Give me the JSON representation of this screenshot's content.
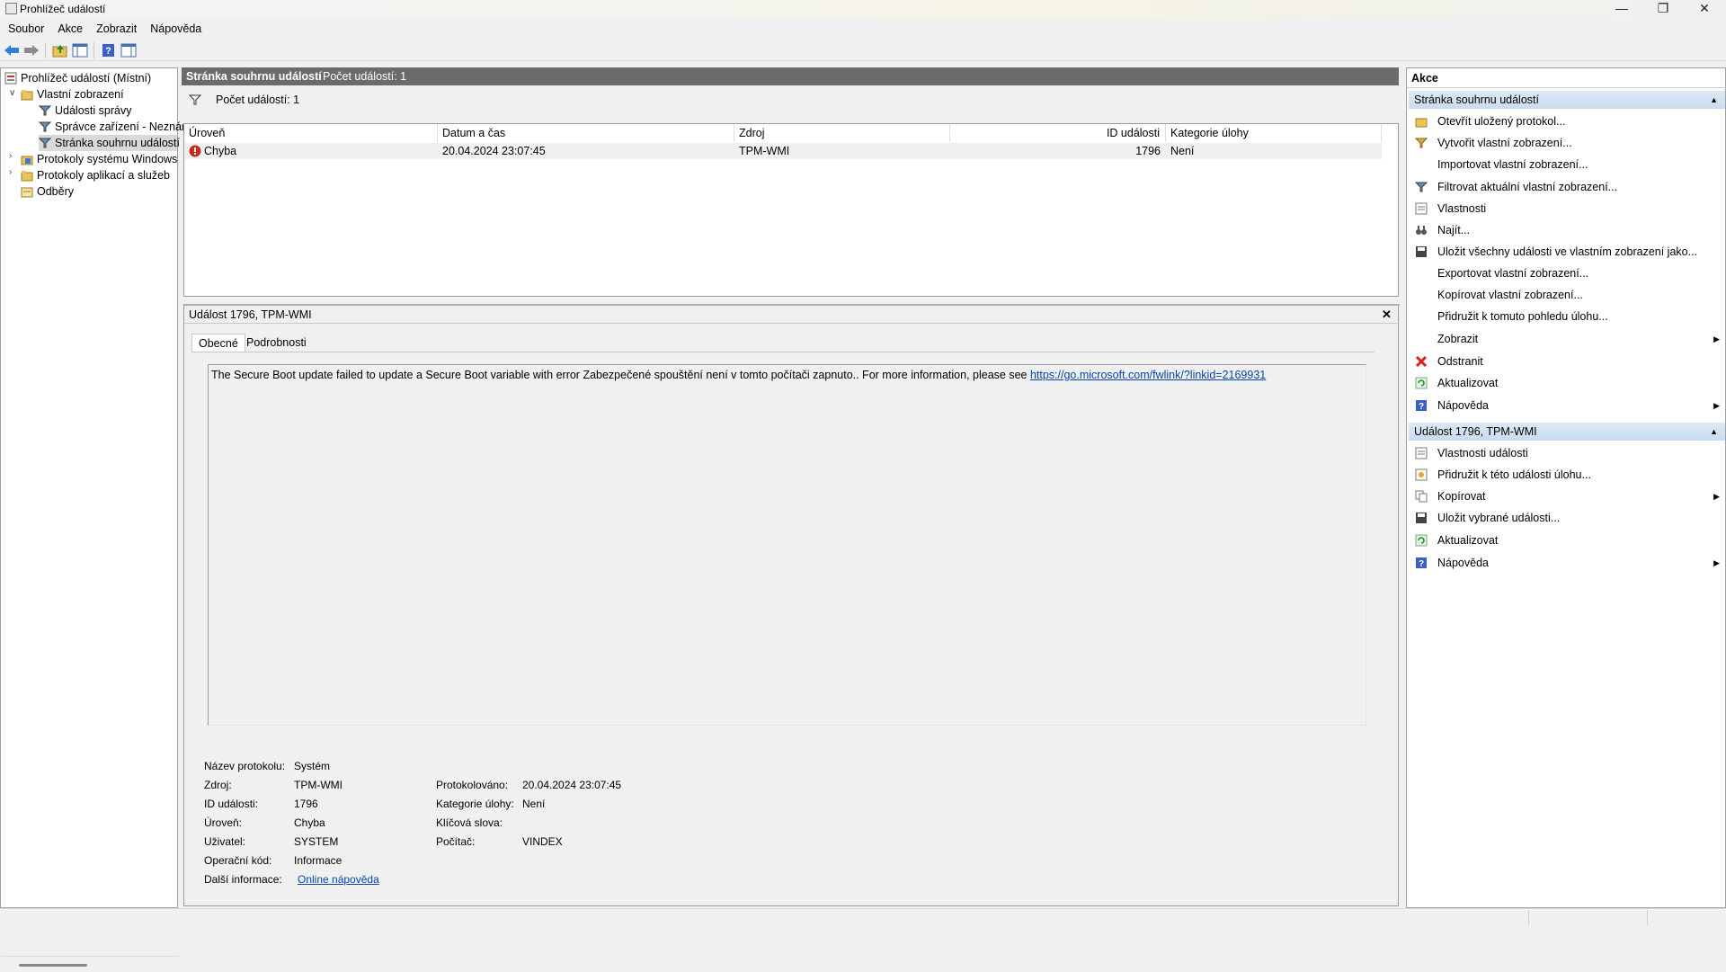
{
  "window": {
    "title": "Prohlížeč událostí"
  },
  "menu": [
    "Soubor",
    "Akce",
    "Zobrazit",
    "Nápověda"
  ],
  "tree": {
    "root": "Prohlížeč událostí (Místní)",
    "custom_views": "Vlastní zobrazení",
    "admin_events": "Události správy",
    "device_manager": "Správce zařízení - Neznár",
    "summary_page": "Stránka souhrnu událostí",
    "windows_logs": "Protokoly systému Windows",
    "app_logs": "Protokoly aplikací a služeb",
    "subscriptions": "Odběry"
  },
  "center": {
    "header_title": "Stránka souhrnu událostí",
    "header_count": "Počet událostí: 1",
    "filter_text": "Počet událostí: 1",
    "columns": [
      "Úroveň",
      "Datum a čas",
      "Zdroj",
      "ID události",
      "Kategorie úlohy"
    ],
    "row": {
      "level": "Chyba",
      "datetime": "20.04.2024 23:07:45",
      "source": "TPM-WMI",
      "id": "1796",
      "category": "Není"
    }
  },
  "detail": {
    "title": "Událost 1796, TPM-WMI",
    "close": "✕",
    "tabs": [
      "Obecné",
      "Podrobnosti"
    ],
    "message": "The Secure Boot update failed to update a Secure Boot variable with error Zabezpečené spouštění není v tomto počítači zapnuto.. For more information, please see ",
    "message_link": "https://go.microsoft.com/fwlink/?linkid=2169931",
    "fields": {
      "log_name_label": "Název protokolu:",
      "log_name": "Systém",
      "source_label": "Zdroj:",
      "source": "TPM-WMI",
      "logged_label": "Protokolováno:",
      "logged": "20.04.2024 23:07:45",
      "id_label": "ID události:",
      "id": "1796",
      "category_label": "Kategorie úlohy:",
      "category": "Není",
      "level_label": "Úroveň:",
      "level": "Chyba",
      "keywords_label": "Klíčová slova:",
      "user_label": "Uživatel:",
      "user": "SYSTEM",
      "computer_label": "Počítač:",
      "computer": "VINDEX",
      "opcode_label": "Operační kód:",
      "opcode": "Informace",
      "more_label": "Další informace:",
      "more_link": "Online nápověda "
    }
  },
  "actions": {
    "title": "Akce",
    "section1": "Stránka souhrnu událostí",
    "items1": [
      "Otevřít uložený protokol...",
      "Vytvořit vlastní zobrazení...",
      "Importovat vlastní zobrazení...",
      "Filtrovat aktuální vlastní zobrazení...",
      "Vlastnosti",
      "Najít...",
      "Uložit všechny události ve vlastním zobrazení jako...",
      "Exportovat vlastní zobrazení...",
      "Kopírovat vlastní zobrazení...",
      "Přidružit k tomuto pohledu úlohu...",
      "Zobrazit",
      "Odstranit",
      "Aktualizovat",
      "Nápověda"
    ],
    "section2": "Událost 1796, TPM-WMI",
    "items2": [
      "Vlastnosti události",
      "Přidružit k této události úlohu...",
      "Kopírovat",
      "Uložit vybrané události...",
      "Aktualizovat",
      "Nápověda"
    ]
  },
  "colors": {
    "section_header": "#c9dcef",
    "error_red": "#c42b1c",
    "link": "#0645ad",
    "header_gray": "#6b6b6b"
  }
}
